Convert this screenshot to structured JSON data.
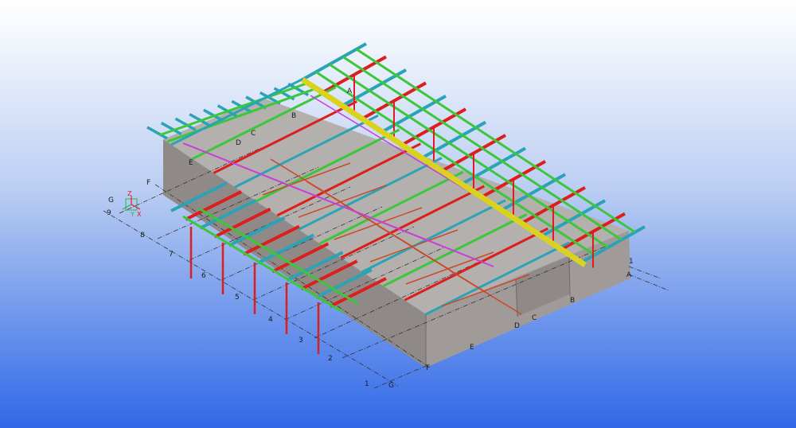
{
  "view": {
    "background_top": "#ffffff",
    "background_bottom": "#3168e8"
  },
  "colors": {
    "wall": "#8f8a88",
    "wall_side": "#a09b99",
    "wall_top": "#b4b0ae",
    "purlin": "#2aa3b6",
    "rafter": "#dc1f1c",
    "brace": "#3cc73a",
    "ridge": "#d9d21f",
    "rod": "#c94a2a",
    "gridline": "#333333"
  },
  "grid_labels": {
    "numbers_front": [
      "1",
      "2",
      "3",
      "4",
      "5",
      "6",
      "7",
      "8",
      "9"
    ],
    "letters_left": [
      "G",
      "F"
    ],
    "letters_bottom": [
      "A",
      "B",
      "C",
      "D",
      "E",
      "F",
      "G"
    ],
    "numbers_right": [
      "1"
    ],
    "letters_roof": [
      "A",
      "B",
      "C",
      "D",
      "E"
    ]
  },
  "axis_indicator": {
    "z": "Z",
    "x": "X",
    "y": "Y"
  }
}
